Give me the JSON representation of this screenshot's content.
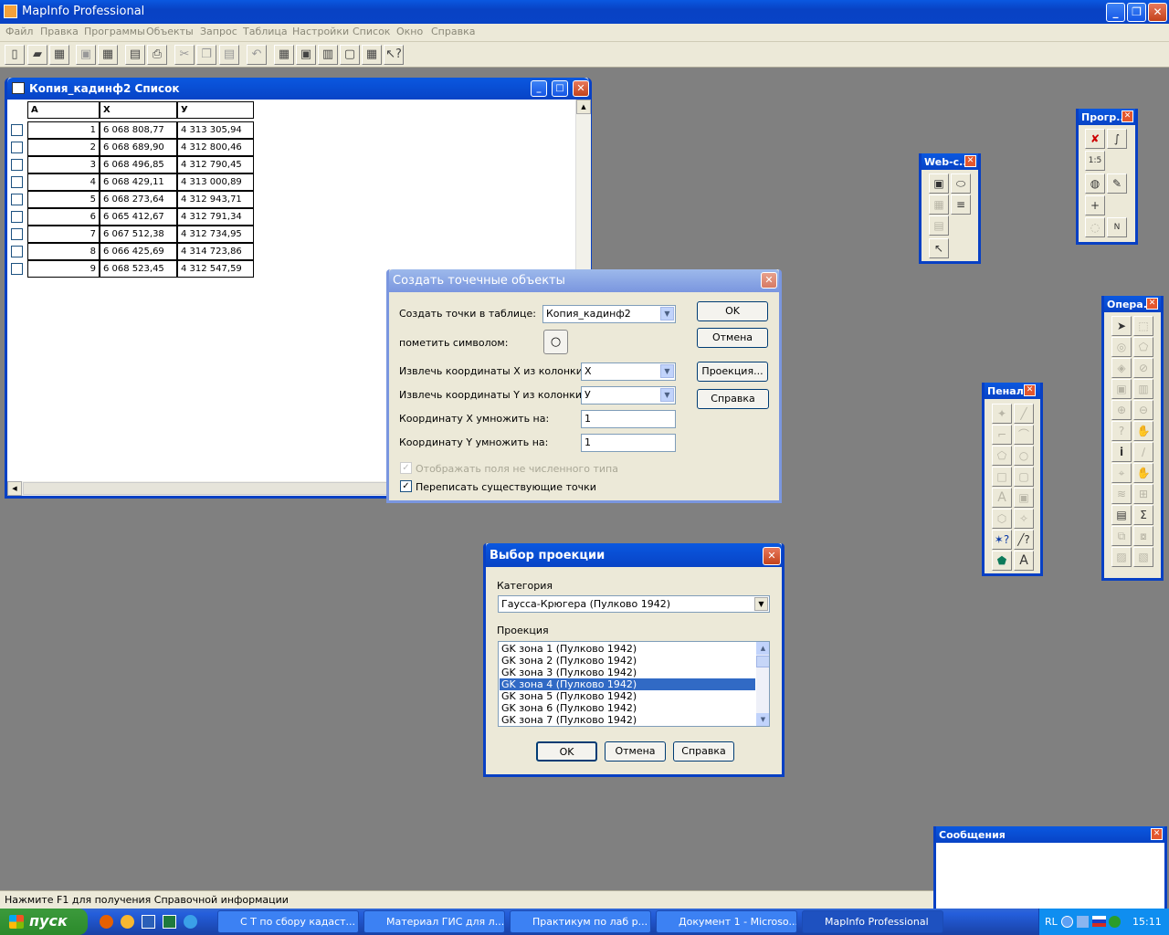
{
  "app": {
    "title": "MapInfo Professional"
  },
  "menu": [
    "Файл",
    "Правка",
    "Программы",
    "Объекты",
    "Запрос",
    "Таблица",
    "Настройки",
    "Список",
    "Окно",
    "Справка"
  ],
  "toolbar_icons": [
    "new-icon",
    "open-icon",
    "open-workspace-icon",
    "save-icon",
    "save-workspace-icon",
    "save-copy-icon",
    "print-icon",
    "cut-icon",
    "copy-icon",
    "paste-icon",
    "undo-icon",
    "new-browser-icon",
    "new-map-icon",
    "new-graph-icon",
    "new-layout-icon",
    "redistrict-icon",
    "help-pointer-icon"
  ],
  "browser": {
    "title": "Копия_кадинф2 Список",
    "columns": [
      "A",
      "X",
      "У"
    ],
    "rows": [
      {
        "a": "1",
        "x": "6 068 808,77",
        "y": "4 313 305,94"
      },
      {
        "a": "2",
        "x": "6 068 689,90",
        "y": "4 312 800,46"
      },
      {
        "a": "3",
        "x": "6 068 496,85",
        "y": "4 312 790,45"
      },
      {
        "a": "4",
        "x": "6 068 429,11",
        "y": "4 313 000,89"
      },
      {
        "a": "5",
        "x": "6 068 273,64",
        "y": "4 312 943,71"
      },
      {
        "a": "6",
        "x": "6 065 412,67",
        "y": "4 312 791,34"
      },
      {
        "a": "7",
        "x": "6 067 512,38",
        "y": "4 312 734,95"
      },
      {
        "a": "8",
        "x": "6 066 425,69",
        "y": "4 314 723,86"
      },
      {
        "a": "9",
        "x": "6 068 523,45",
        "y": "4 312 547,59"
      }
    ]
  },
  "create_points": {
    "title": "Создать точечные объекты",
    "table_label": "Создать точки в таблице:",
    "table_value": "Копия_кадинф2",
    "symbol_label": "пометить символом:",
    "x_col_label": "Извлечь координаты X из колонки:",
    "x_col_value": "X",
    "y_col_label": "Извлечь координаты Y из колонки:",
    "y_col_value": "У",
    "x_mult_label": "Координату X умножить на:",
    "x_mult_value": "1",
    "y_mult_label": "Координату Y умножить на:",
    "y_mult_value": "1",
    "nonnumeric_label": "Отображать поля не численного типа",
    "overwrite_label": "Переписать существующие точки",
    "ok": "OK",
    "cancel": "Отмена",
    "projection": "Проекция...",
    "help": "Справка"
  },
  "projection": {
    "title": "Выбор проекции",
    "category_label": "Категория",
    "category_value": "Гаусса-Крюгера (Пулково 1942)",
    "projection_label": "Проекция",
    "items": [
      "GK зона 1  (Пулково 1942)",
      "GK зона 2  (Пулково 1942)",
      "GK зона 3  (Пулково 1942)",
      "GK зона 4  (Пулково 1942)",
      "GK зона 5  (Пулково 1942)",
      "GK зона 6  (Пулково 1942)",
      "GK зона 7  (Пулково 1942)"
    ],
    "selected_index": 3,
    "ok": "OK",
    "cancel": "Отмена",
    "help": "Справка"
  },
  "palettes": {
    "web": "Web-c...",
    "programs": "Прогр...",
    "drawing": "Пенал",
    "operations": "Опера...",
    "messages": "Сообщения"
  },
  "status": "Нажмите F1 для получения Справочной информации",
  "taskbar": {
    "start": "пуск",
    "tasks": [
      "С Т по сбору кадаст...",
      "Материал ГИС для л...",
      "Практикум по лаб р...",
      "Документ 1 - Microso...",
      "MapInfo Professional"
    ],
    "lang": "RL",
    "clock": "15:11"
  }
}
